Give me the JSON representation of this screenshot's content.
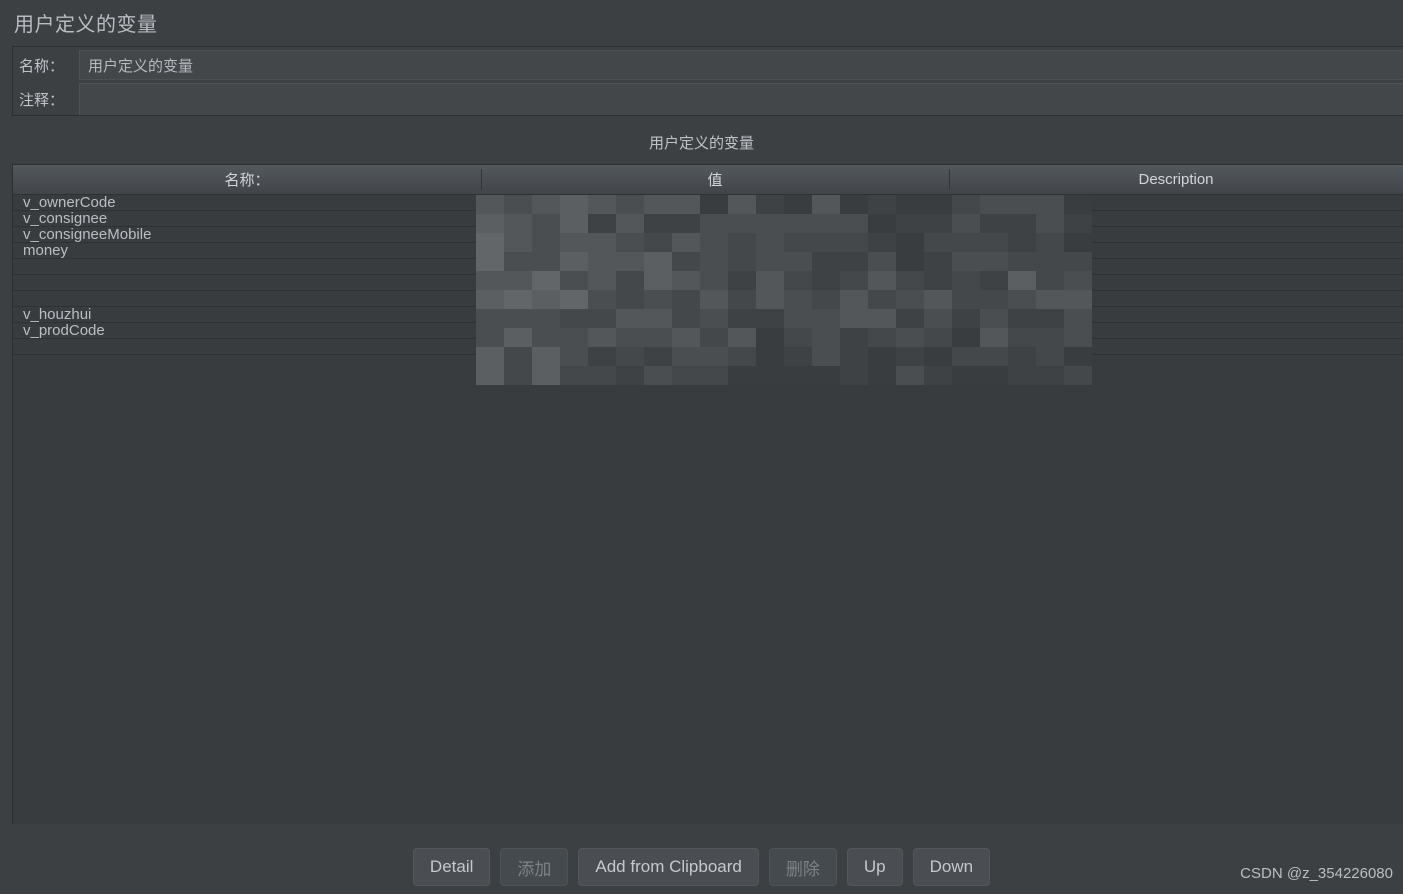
{
  "panel": {
    "title": "用户定义的变量"
  },
  "form": {
    "name_label": "名称：",
    "name_value": "用户定义的变量",
    "comment_label": "注释：",
    "comment_value": ""
  },
  "table": {
    "caption": "用户定义的变量",
    "columns": [
      "名称：",
      "值",
      "Description"
    ],
    "rows": [
      {
        "name": "v_ownerCode",
        "value": "",
        "description": ""
      },
      {
        "name": "v_consignee",
        "value": "",
        "description": ""
      },
      {
        "name": "v_consigneeMobile",
        "value": "",
        "description": ""
      },
      {
        "name": "money",
        "value": "",
        "description": ""
      },
      {
        "name": "",
        "value": "",
        "description": ""
      },
      {
        "name": "",
        "value": "",
        "description": ""
      },
      {
        "name": "",
        "value": "",
        "description": ""
      },
      {
        "name": "v_houzhui",
        "value": "",
        "description": ""
      },
      {
        "name": "v_prodCode",
        "value": "",
        "description": ""
      },
      {
        "name": "",
        "value": "",
        "description": ""
      }
    ]
  },
  "buttons": [
    {
      "label": "Detail",
      "enabled": true
    },
    {
      "label": "添加",
      "enabled": false
    },
    {
      "label": "Add from Clipboard",
      "enabled": true
    },
    {
      "label": "删除",
      "enabled": false
    },
    {
      "label": "Up",
      "enabled": true
    },
    {
      "label": "Down",
      "enabled": true
    }
  ],
  "watermark": "CSDN @z_354226080",
  "colors": {
    "background": "#3c4043",
    "table_background": "#393c3f",
    "header_gradient_top": "#53585c",
    "header_gradient_bottom": "#414548",
    "text": "#bfc4c9",
    "row_separator": "#2f3235",
    "button_face": "#4a4e52"
  }
}
